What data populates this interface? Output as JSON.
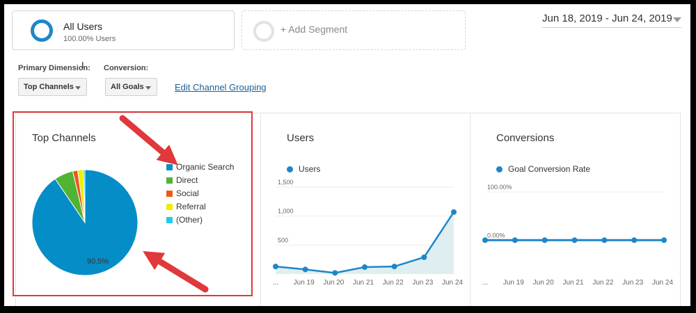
{
  "segments": {
    "active": {
      "name": "All Users",
      "sub": "100.00% Users"
    },
    "add_label": "+ Add Segment"
  },
  "date_range": "Jun 18, 2019 - Jun 24, 2019",
  "controls": {
    "primary_dimension_label": "Primary Dimension:",
    "primary_dimension_value": "Top Channels",
    "conversion_label": "Conversion:",
    "conversion_value": "All Goals",
    "edit_link": "Edit Channel Grouping"
  },
  "colors": {
    "accent": "#1f86c8",
    "highlight": "#e0383b",
    "area_fill": "#dfeef1"
  },
  "chart_data": [
    {
      "type": "pie",
      "title": "Top Channels",
      "labels": [
        "Organic Search",
        "Direct",
        "Social",
        "Referral",
        "(Other)"
      ],
      "values": [
        90.5,
        5.8,
        1.5,
        1.7,
        0.5
      ],
      "colors": [
        "#058dc7",
        "#50b432",
        "#ed561b",
        "#edef00",
        "#24cbe5"
      ],
      "value_label": "90.5%",
      "legend": "right"
    },
    {
      "type": "area",
      "title": "Users",
      "series": [
        {
          "name": "Users",
          "values": [
            130,
            80,
            20,
            120,
            130,
            290,
            1070
          ]
        }
      ],
      "categories": [
        "...",
        "Jun 19",
        "Jun 20",
        "Jun 21",
        "Jun 22",
        "Jun 23",
        "Jun 24"
      ],
      "yticks": [
        "1,500",
        "1,000",
        "500"
      ],
      "ylim": [
        0,
        1500
      ],
      "legend": "top-left"
    },
    {
      "type": "line",
      "title": "Conversions",
      "series": [
        {
          "name": "Goal Conversion Rate",
          "values": [
            0,
            0,
            0,
            0,
            0,
            0,
            0
          ]
        }
      ],
      "categories": [
        "...",
        "Jun 19",
        "Jun 20",
        "Jun 21",
        "Jun 22",
        "Jun 23",
        "Jun 24"
      ],
      "yticks": [
        "100.00%",
        "0.00%"
      ],
      "ylim": [
        -40,
        100
      ],
      "legend": "top-left"
    }
  ]
}
